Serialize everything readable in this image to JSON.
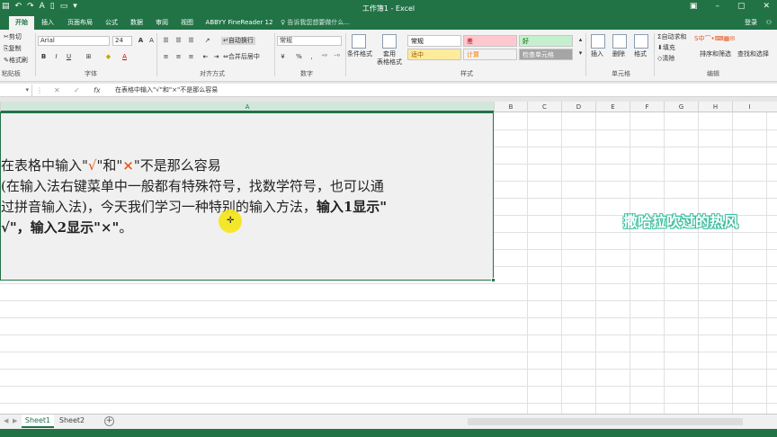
{
  "titlebar": {
    "title": "工作簿1 - Excel",
    "qat_icons": [
      "save-icon",
      "undo-icon",
      "redo-icon",
      "new-file-icon"
    ]
  },
  "tabs": [
    "开始",
    "插入",
    "页面布局",
    "公式",
    "数据",
    "审阅",
    "视图",
    "ABBYY FineReader 12"
  ],
  "active_tab": "开始",
  "tell_me": "♀ 告诉我您想要做什么...",
  "login": "登录",
  "share": "共享",
  "ribbon": {
    "clipboard": {
      "cut": "剪切",
      "copy": "复制",
      "format_painter": "格式刷",
      "label": "粘贴板"
    },
    "font": {
      "name": "Arial",
      "size": "24",
      "label": "字体",
      "grow": "A",
      "shrink": "A",
      "bold": "B",
      "italic": "I",
      "underline": "U",
      "font_color": "A"
    },
    "alignment": {
      "wrap": "自动换行",
      "merge": "合并后居中",
      "label": "对齐方式"
    },
    "number": {
      "format": "常规",
      "percent": "%",
      "comma": ",",
      "label": "数字"
    },
    "styles": {
      "conditional": "条件格式",
      "table_format": "套用\n表格格式",
      "cells": [
        {
          "text": "常规",
          "bg": "#ffffff",
          "fg": "#000000"
        },
        {
          "text": "差",
          "bg": "#ffc7ce",
          "fg": "#9c0006"
        },
        {
          "text": "好",
          "bg": "#c6efce",
          "fg": "#006100"
        },
        {
          "text": "适中",
          "bg": "#ffeb9c",
          "fg": "#9c5700"
        },
        {
          "text": "计算",
          "bg": "#f2f2f2",
          "fg": "#fa7d00"
        },
        {
          "text": "检查单元格",
          "bg": "#a5a5a5",
          "fg": "#ffffff"
        }
      ],
      "label": "样式"
    },
    "cells_group": {
      "insert": "插入",
      "delete": "删除",
      "format": "格式",
      "label": "单元格"
    },
    "editing": {
      "autosum": "自动求和",
      "fill": "填充",
      "clear": "清除",
      "sort_filter": "排序和筛选",
      "find_select": "查找和选择",
      "label": "编辑"
    }
  },
  "formula_bar": {
    "fx": "fx",
    "content": "在表格中输入\"√\"和\"×\"不是那么容易"
  },
  "columns": [
    {
      "name": "A",
      "selected": true
    },
    {
      "name": "B"
    },
    {
      "name": "C"
    },
    {
      "name": "D"
    },
    {
      "name": "E"
    },
    {
      "name": "F"
    },
    {
      "name": "G"
    },
    {
      "name": "H"
    },
    {
      "name": "I"
    }
  ],
  "cell_a1": {
    "line1_pre": "在表格中输入\"",
    "check": "√",
    "line1_mid": "\"和\"",
    "cross": "×",
    "line1_post": "\"不是那么容易",
    "line2": "(在输入法右键菜单中一般都有特殊符号，找数学符号，也可以通",
    "line3_pre": "过拼音输入法)，今天我们学习一种特别的输入方法，",
    "line3_bold": "输入1显示\"",
    "line4_bold": "√\"，输入2显示\"×\"",
    "line4_post": "。"
  },
  "cursor_symbol": "✛",
  "watermark": "撒哈拉吹过的热风",
  "sheets": [
    {
      "name": "Sheet1",
      "active": true
    },
    {
      "name": "Sheet2"
    }
  ],
  "add_sheet": "+",
  "accent": "#217346"
}
